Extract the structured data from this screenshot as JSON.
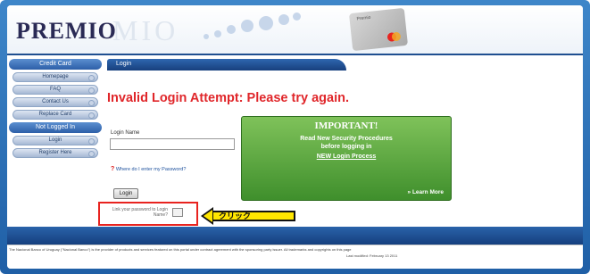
{
  "header": {
    "logo": "PREMIO",
    "logo_ghost": "MIO",
    "card_label": "Premio"
  },
  "sidebar": {
    "sections": [
      {
        "title": "Credit Card",
        "items": [
          "Homepage",
          "FAQ",
          "Contact Us",
          "Replace Card"
        ]
      },
      {
        "title": "Not Logged In",
        "items": [
          "Login",
          "Register Here"
        ]
      }
    ]
  },
  "main": {
    "tab": "Login",
    "error": "Invalid Login Attempt: Please try again.",
    "login_name_label": "Login Name",
    "login_name_value": "",
    "forgot_password": "Where do I enter my Password?",
    "login_button": "Login",
    "remember": "Link your password to Login Name?"
  },
  "important": {
    "title": "IMPORTANT!",
    "lines": [
      "Read New Security Procedures",
      "before logging in",
      "NEW Login Process"
    ],
    "learn_more": "» Learn More"
  },
  "callout": {
    "text": "クリック"
  },
  "footer": {
    "notice": "The Nacional Banco of Uruguay (\"Nacional Banco\") is the provider of products and services featured on this portal under contract agreement with the sponsoring party issuer. All trademarks and copyrights on this page",
    "last_modified": "Last modified: February 13 2011"
  },
  "colors": {
    "accent": "#1f5fa6",
    "error": "#e0262a",
    "important_bg": "#4f9e36",
    "highlight": "#e8231f",
    "callout": "#ffe600"
  }
}
